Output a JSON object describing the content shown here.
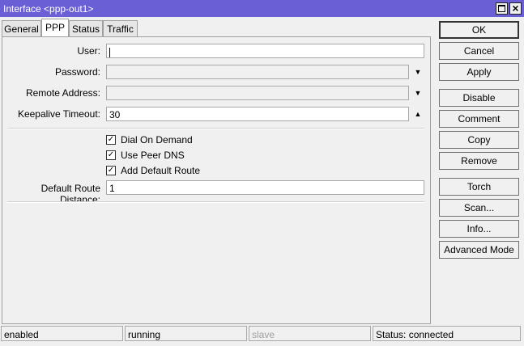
{
  "window": {
    "title": "Interface <ppp-out1>",
    "titlebar_color": "#6b5fd6"
  },
  "tabs": [
    {
      "label": "General"
    },
    {
      "label": "PPP",
      "active": true
    },
    {
      "label": "Status"
    },
    {
      "label": "Traffic"
    }
  ],
  "form": {
    "user": {
      "label": "User:",
      "value": ""
    },
    "password": {
      "label": "Password:",
      "value": ""
    },
    "remote_address": {
      "label": "Remote Address:",
      "value": ""
    },
    "keepalive_timeout": {
      "label": "Keepalive Timeout:",
      "value": "30"
    },
    "dial_on_demand": {
      "label": "Dial On Demand",
      "checked": true
    },
    "use_peer_dns": {
      "label": "Use Peer DNS",
      "checked": true
    },
    "add_default_route": {
      "label": "Add Default Route",
      "checked": true
    },
    "default_route_distance": {
      "label": "Default Route Distance:",
      "value": "1"
    }
  },
  "buttons": {
    "ok": "OK",
    "cancel": "Cancel",
    "apply": "Apply",
    "disable": "Disable",
    "comment": "Comment",
    "copy": "Copy",
    "remove": "Remove",
    "torch": "Torch",
    "scan": "Scan...",
    "info": "Info...",
    "advanced_mode": "Advanced Mode"
  },
  "statusbar": {
    "state": "enabled",
    "run": "running",
    "slave": "slave",
    "status": "Status: connected"
  },
  "icons": {
    "dropdown": "triangle-down-icon",
    "spinner_up": "triangle-up-icon",
    "check": "checkmark-icon"
  }
}
